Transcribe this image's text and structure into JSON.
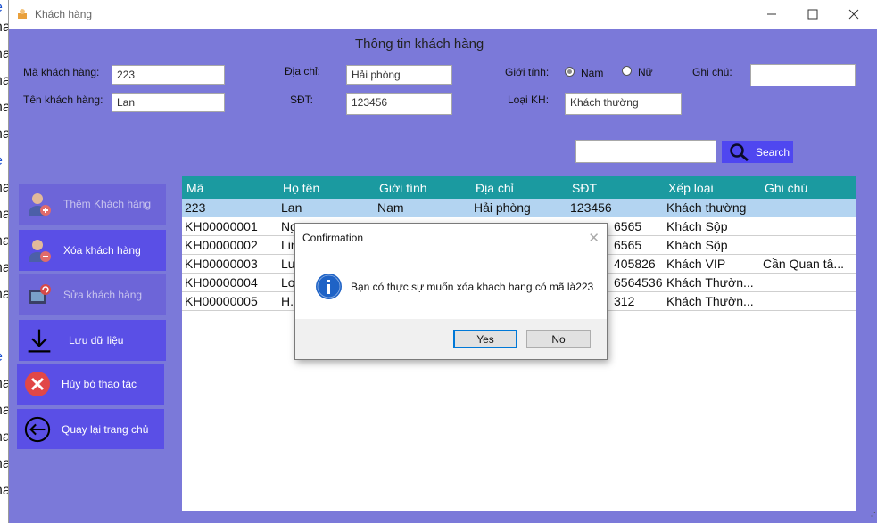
{
  "window": {
    "title": "Khách hàng"
  },
  "form": {
    "heading": "Thông tin khách hàng",
    "ma_label": "Mã khách hàng:",
    "ma_value": "223",
    "ten_label": "Tên khách hàng:",
    "ten_value": "Lan",
    "diachi_label": "Địa chỉ:",
    "diachi_value": "Hải phòng",
    "sdt_label": "SĐT:",
    "sdt_value": "123456",
    "gioitinh_label": "Giới tính:",
    "gender_options": [
      "Nam",
      "Nữ"
    ],
    "gender_selected": "Nam",
    "loaikh_label": "Loại KH:",
    "loaikh_value": "Khách thường",
    "ghichu_label": "Ghi chú:",
    "ghichu_value": ""
  },
  "search": {
    "value": "",
    "button_label": "Search"
  },
  "sidebar": {
    "add": "Thêm Khách hàng",
    "delete": "Xóa khách hàng",
    "edit": "Sửa khách hàng",
    "save": "Lưu dữ liệu",
    "cancel": "Hủy bỏ thao tác",
    "home": "Quay lại trang chủ"
  },
  "grid": {
    "columns": [
      "Mã",
      "Họ tên",
      "Giới tính",
      "Địa chỉ",
      "SĐT",
      "Xếp loại",
      "Ghi chú"
    ],
    "rows": [
      [
        "223",
        "Lan",
        "Nam",
        "Hải phòng",
        "123456",
        "Khách thường",
        ""
      ],
      [
        "KH00000001",
        "Ng",
        "",
        "",
        "6565",
        "Khách Sộp",
        ""
      ],
      [
        "KH00000002",
        "Lin",
        "",
        "",
        "6565",
        "Khách Sộp",
        ""
      ],
      [
        "KH00000003",
        "Lu",
        "",
        "",
        "405826",
        "Khách VIP",
        "Cần Quan tâ..."
      ],
      [
        "KH00000004",
        "Lo",
        "",
        "",
        "6564536",
        "Khách Thườn...",
        ""
      ],
      [
        "KH00000005",
        "H.",
        "",
        "",
        "312",
        "Khách Thườn...",
        ""
      ]
    ]
  },
  "dialog": {
    "title": "Confirmation",
    "message": "Bạn có thực sự muốn xóa khach hang có mã là223",
    "yes": "Yes",
    "no": "No"
  },
  "background_fragments": [
    "e",
    "na",
    "na",
    "na",
    "na",
    "na",
    "e",
    "na",
    "na",
    "na",
    "na",
    "na",
    "e",
    "na",
    "na",
    "na",
    "na",
    "na"
  ],
  "colors": {
    "window_bg": "#7b79d9",
    "button": "#5a4fe6",
    "grid_header": "#1b9aa0",
    "selected_row": "#b3d4f1",
    "search_btn": "#4f47f0"
  }
}
